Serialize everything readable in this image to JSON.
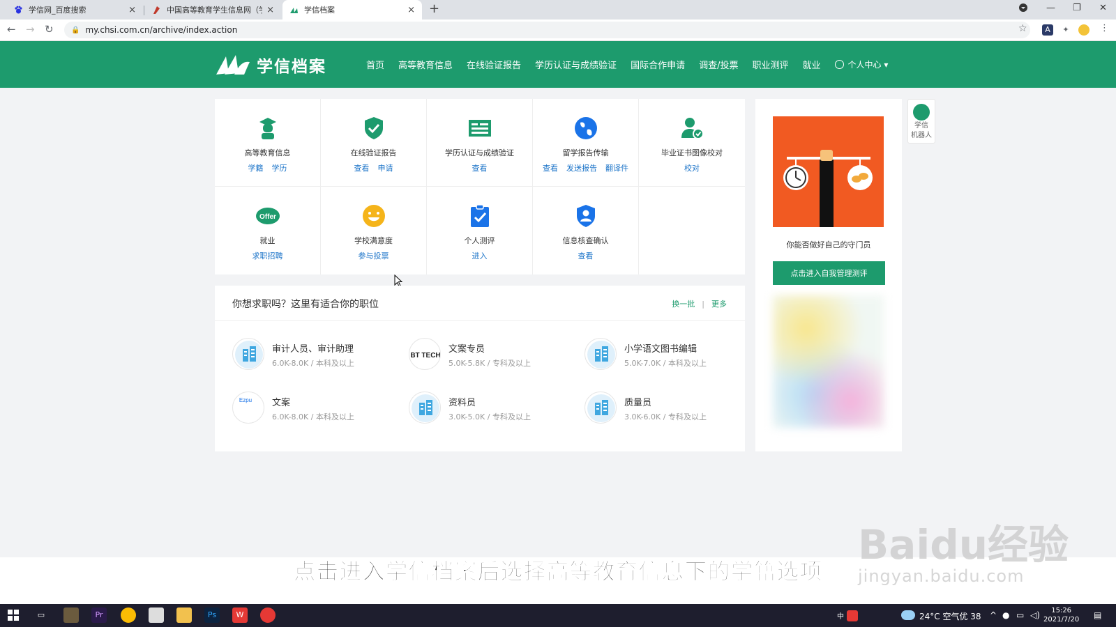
{
  "browser": {
    "tabs": [
      {
        "title": "学信网_百度搜索",
        "close": "×"
      },
      {
        "title": "中国高等教育学生信息网（学信网）",
        "close": "×"
      },
      {
        "title": "学信档案",
        "close": "×"
      }
    ],
    "new_tab": "+",
    "url": "my.chsi.com.cn/archive/index.action"
  },
  "site": {
    "logo_text": "学信档案",
    "nav": [
      "首页",
      "高等教育信息",
      "在线验证报告",
      "学历认证与成绩验证",
      "国际合作申请",
      "调查/投票",
      "职业测评",
      "就业"
    ],
    "user_center": "个人中心 ▾"
  },
  "services": [
    {
      "name": "高等教育信息",
      "links": [
        "学籍",
        "学历"
      ],
      "icon": "graduate-icon"
    },
    {
      "name": "在线验证报告",
      "links": [
        "查看",
        "申请"
      ],
      "icon": "shield-check-icon"
    },
    {
      "name": "学历认证与成绩验证",
      "links": [
        "查看"
      ],
      "icon": "id-card-icon"
    },
    {
      "name": "留学报告传输",
      "links": [
        "查看",
        "发送报告",
        "翻译件"
      ],
      "icon": "globe-icon"
    },
    {
      "name": "毕业证书图像校对",
      "links": [
        "校对"
      ],
      "icon": "user-check-icon"
    },
    {
      "name": "就业",
      "links": [
        "求职招聘"
      ],
      "icon": "offer-icon",
      "icon_text": "Offer"
    },
    {
      "name": "学校满意度",
      "links": [
        "参与投票"
      ],
      "icon": "smiley-icon"
    },
    {
      "name": "个人测评",
      "links": [
        "进入"
      ],
      "icon": "clipboard-check-icon"
    },
    {
      "name": "信息核查确认",
      "links": [
        "查看"
      ],
      "icon": "user-shield-icon"
    }
  ],
  "jobs": {
    "title": "你想求职吗？这里有适合你的职位",
    "refresh": "换一批",
    "separator": "|",
    "more": "更多",
    "items": [
      {
        "title": "审计人员、审计助理",
        "salary": "6.0K-8.0K",
        "edu": "本科及以上",
        "logo": "building-icon"
      },
      {
        "title": "文案专员",
        "salary": "5.0K-5.8K",
        "edu": "专科及以上",
        "logo": "bt-tech-logo",
        "logo_text": "BT TECH"
      },
      {
        "title": "小学语文图书编辑",
        "salary": "5.0K-7.0K",
        "edu": "本科及以上",
        "logo": "building-icon"
      },
      {
        "title": "文案",
        "salary": "6.0K-8.0K",
        "edu": "本科及以上",
        "logo": "company-logo",
        "logo_text": "Ezpu"
      },
      {
        "title": "资料员",
        "salary": "3.0K-5.0K",
        "edu": "专科及以上",
        "logo": "building-icon"
      },
      {
        "title": "质量员",
        "salary": "3.0K-6.0K",
        "edu": "专科及以上",
        "logo": "building-icon"
      }
    ],
    "slash": "/"
  },
  "ad": {
    "caption": "你能否做好自己的守门员",
    "button": "点击进入自我管理测评"
  },
  "robot": {
    "line1": "学信",
    "line2": "机器人"
  },
  "subtitle": "点击进入学信档案后选择高等教育信息下的学籍选项",
  "watermark": {
    "big": "Baidu经验",
    "small": "jingyan.baidu.com"
  },
  "taskbar": {
    "ime": "中",
    "weather": "24°C 空气优 38",
    "time": "15:26",
    "date": "2021/7/20"
  },
  "colors": {
    "brand": "#1d9b6d",
    "link": "#1a73c8",
    "ad_bg": "#f15a22"
  }
}
